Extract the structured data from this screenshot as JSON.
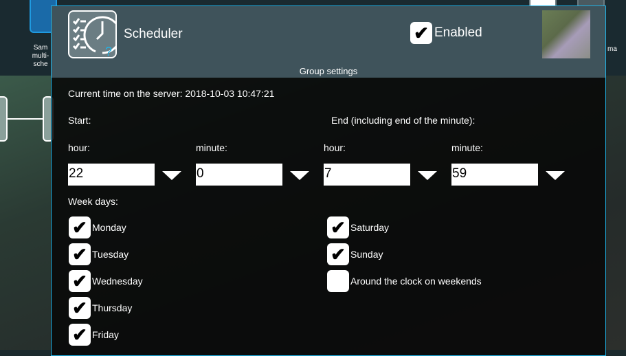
{
  "background": {
    "labels": [
      "Sam multi- sche",
      "ma"
    ]
  },
  "dialog": {
    "title": "Scheduler",
    "enabled": {
      "label": "Enabled",
      "checked": true
    },
    "section": "Group settings",
    "server_time": "Current time on the server: 2018-10-03 10:47:21",
    "start_label": "Start:",
    "end_label": "End (including end of the minute):",
    "fields": [
      {
        "label": "hour:",
        "value": "22"
      },
      {
        "label": "minute:",
        "value": "0"
      },
      {
        "label": "hour:",
        "value": "7"
      },
      {
        "label": "minute:",
        "value": "59"
      }
    ],
    "week_days_label": "Week days:",
    "days": [
      {
        "label": "Monday",
        "checked": true
      },
      {
        "label": "Tuesday",
        "checked": true
      },
      {
        "label": "Wednesday",
        "checked": true
      },
      {
        "label": "Thursday",
        "checked": true
      },
      {
        "label": "Friday",
        "checked": true
      },
      {
        "label": "Saturday",
        "checked": true
      },
      {
        "label": "Sunday",
        "checked": true
      },
      {
        "label": "Around the clock on weekends",
        "checked": false
      }
    ],
    "accent": "#1fb4e8"
  }
}
